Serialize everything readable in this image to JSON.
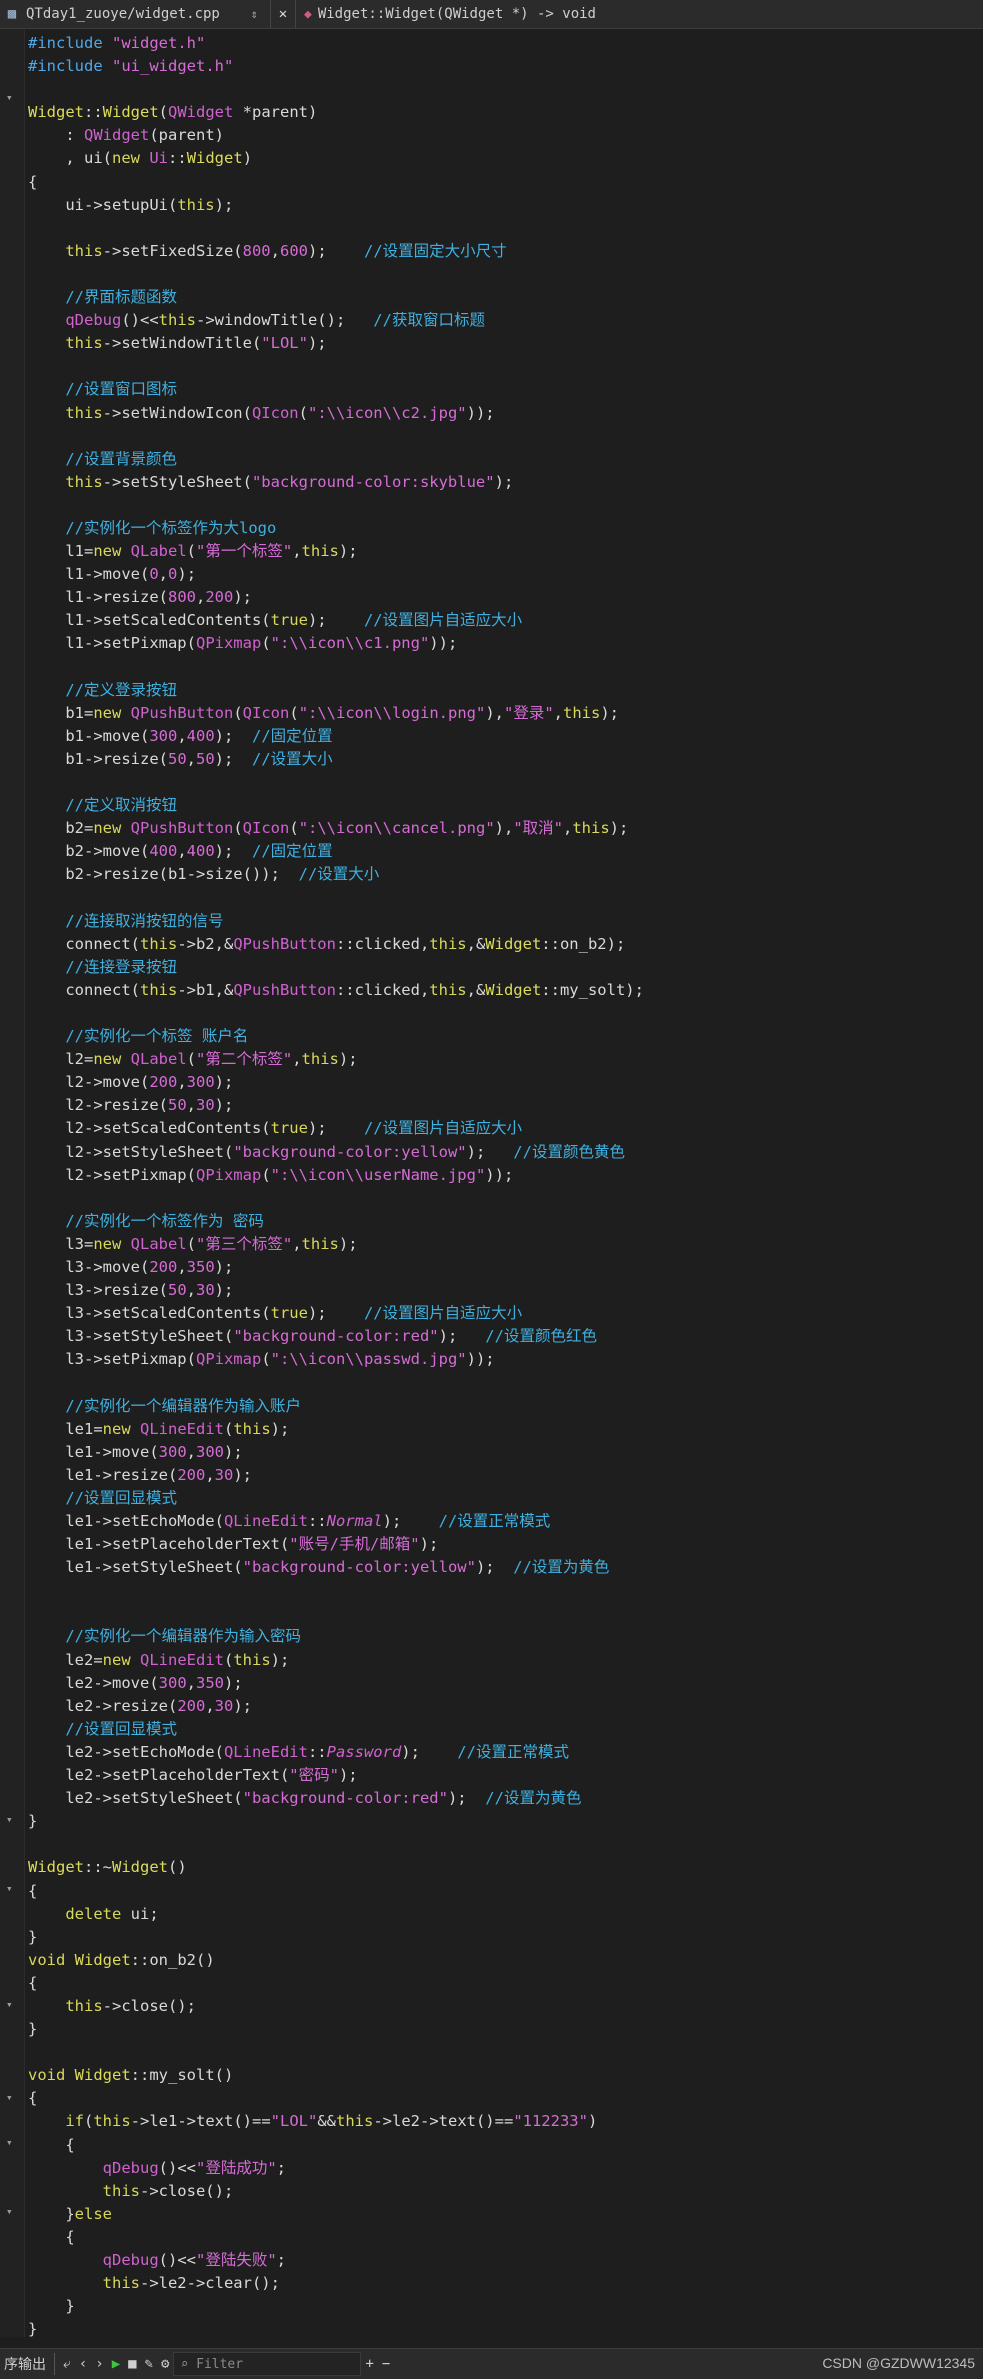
{
  "topbar": {
    "file_tab": "QTday1_zuoye/widget.cpp",
    "updown": "⇕",
    "close": "✕",
    "function_signature": "Widget::Widget(QWidget *) -> void"
  },
  "bottombar": {
    "left_label": "序输出",
    "filter_placeholder": "Filter",
    "add": "+",
    "remove": "−",
    "watermark": "CSDN @GZDWW12345"
  },
  "code_lines": [
    "#include \"widget.h\"",
    "#include \"ui_widget.h\"",
    "",
    "Widget::Widget(QWidget *parent)",
    "    : QWidget(parent)",
    "    , ui(new Ui::Widget)",
    "{",
    "    ui->setupUi(this);",
    "",
    "    this->setFixedSize(800,600);    //设置固定大小尺寸",
    "",
    "    //界面标题函数",
    "    qDebug()<<this->windowTitle();   //获取窗口标题",
    "    this->setWindowTitle(\"LOL\");",
    "",
    "    //设置窗口图标",
    "    this->setWindowIcon(QIcon(\":\\\\icon\\\\c2.jpg\"));",
    "",
    "    //设置背景颜色",
    "    this->setStyleSheet(\"background-color:skyblue\");",
    "",
    "    //实例化一个标签作为大logo",
    "    l1=new QLabel(\"第一个标签\",this);",
    "    l1->move(0,0);",
    "    l1->resize(800,200);",
    "    l1->setScaledContents(true);    //设置图片自适应大小",
    "    l1->setPixmap(QPixmap(\":\\\\icon\\\\c1.png\"));",
    "",
    "    //定义登录按钮",
    "    b1=new QPushButton(QIcon(\":\\\\icon\\\\login.png\"),\"登录\",this);",
    "    b1->move(300,400);  //固定位置",
    "    b1->resize(50,50);  //设置大小",
    "",
    "    //定义取消按钮",
    "    b2=new QPushButton(QIcon(\":\\\\icon\\\\cancel.png\"),\"取消\",this);",
    "    b2->move(400,400);  //固定位置",
    "    b2->resize(b1->size());  //设置大小",
    "",
    "    //连接取消按钮的信号",
    "    connect(this->b2,&QPushButton::clicked,this,&Widget::on_b2);",
    "    //连接登录按钮",
    "    connect(this->b1,&QPushButton::clicked,this,&Widget::my_solt);",
    "",
    "    //实例化一个标签 账户名",
    "    l2=new QLabel(\"第二个标签\",this);",
    "    l2->move(200,300);",
    "    l2->resize(50,30);",
    "    l2->setScaledContents(true);    //设置图片自适应大小",
    "    l2->setStyleSheet(\"background-color:yellow\");   //设置颜色黄色",
    "    l2->setPixmap(QPixmap(\":\\\\icon\\\\userName.jpg\"));",
    "",
    "    //实例化一个标签作为 密码",
    "    l3=new QLabel(\"第三个标签\",this);",
    "    l3->move(200,350);",
    "    l3->resize(50,30);",
    "    l3->setScaledContents(true);    //设置图片自适应大小",
    "    l3->setStyleSheet(\"background-color:red\");   //设置颜色红色",
    "    l3->setPixmap(QPixmap(\":\\\\icon\\\\passwd.jpg\"));",
    "",
    "    //实例化一个编辑器作为输入账户",
    "    le1=new QLineEdit(this);",
    "    le1->move(300,300);",
    "    le1->resize(200,30);",
    "    //设置回显模式",
    "    le1->setEchoMode(QLineEdit::Normal);    //设置正常模式",
    "    le1->setPlaceholderText(\"账号/手机/邮箱\");",
    "    le1->setStyleSheet(\"background-color:yellow\");  //设置为黄色",
    "",
    "",
    "    //实例化一个编辑器作为输入密码",
    "    le2=new QLineEdit(this);",
    "    le2->move(300,350);",
    "    le2->resize(200,30);",
    "    //设置回显模式",
    "    le2->setEchoMode(QLineEdit::Password);    //设置正常模式",
    "    le2->setPlaceholderText(\"密码\");",
    "    le2->setStyleSheet(\"background-color:red\");  //设置为黄色",
    "}",
    "",
    "Widget::~Widget()",
    "{",
    "    delete ui;",
    "}",
    "void Widget::on_b2()",
    "{",
    "    this->close();",
    "}",
    "",
    "void Widget::my_solt()",
    "{",
    "    if(this->le1->text()==\"LOL\"&&this->le2->text()==\"112233\")",
    "    {",
    "        qDebug()<<\"登陆成功\";",
    "        this->close();",
    "    }else",
    "    {",
    "        qDebug()<<\"登陆失败\";",
    "        this->le2->clear();",
    "    }",
    "}"
  ]
}
